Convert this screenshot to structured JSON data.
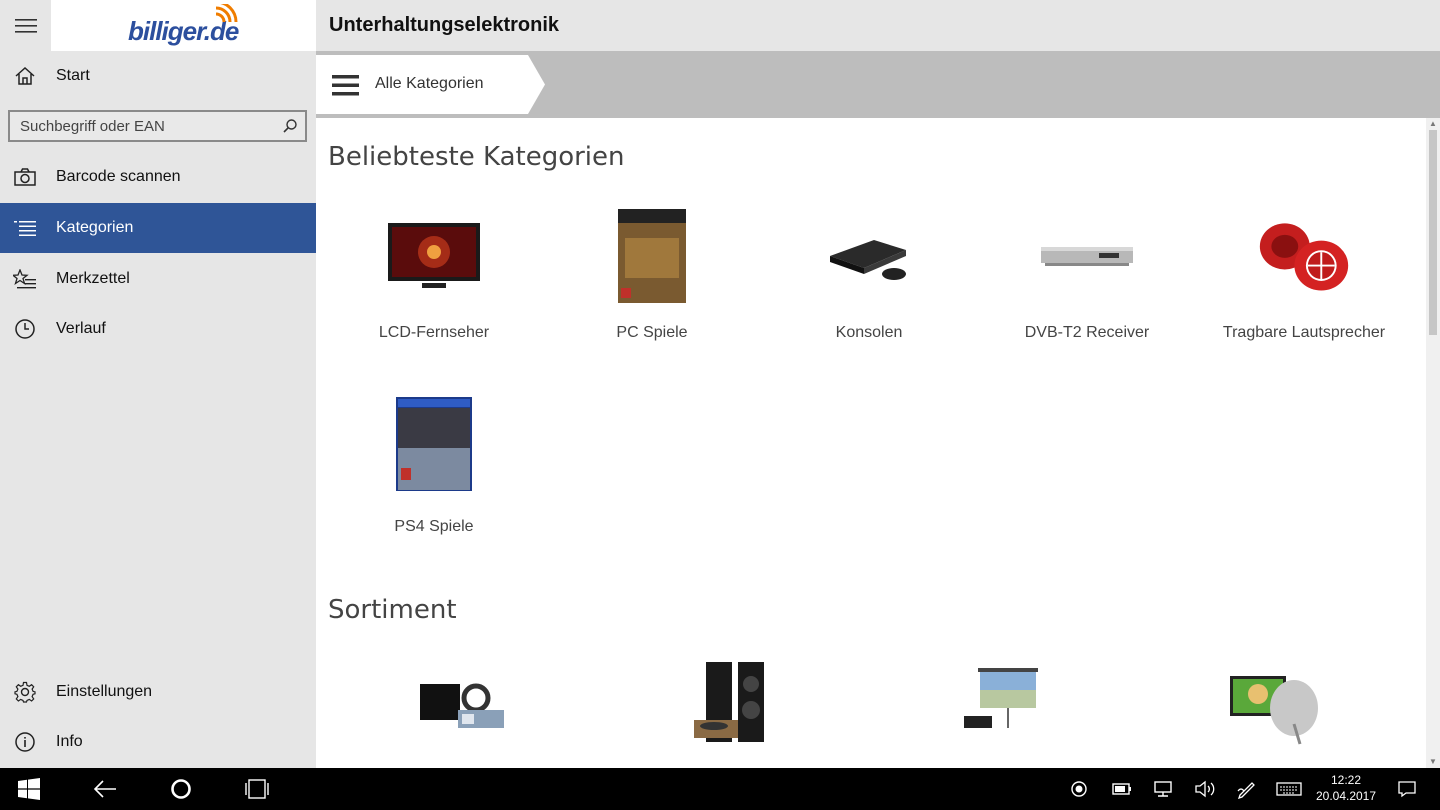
{
  "app": {
    "logo_text": "billiger.de",
    "page_title": "Unterhaltungselektronik"
  },
  "sidebar": {
    "search_placeholder": "Suchbegriff oder EAN",
    "items": [
      {
        "label": "Start",
        "icon": "home-icon"
      },
      {
        "label": "Barcode scannen",
        "icon": "camera-icon"
      },
      {
        "label": "Kategorien",
        "icon": "list-icon",
        "active": true
      },
      {
        "label": "Merkzettel",
        "icon": "star-list-icon"
      },
      {
        "label": "Verlauf",
        "icon": "clock-icon"
      }
    ],
    "bottom_items": [
      {
        "label": "Einstellungen",
        "icon": "gear-icon"
      },
      {
        "label": "Info",
        "icon": "info-icon"
      }
    ]
  },
  "breadcrumb": {
    "label": "Alle Kategorien"
  },
  "sections": {
    "popular_title": "Beliebteste Kategorien",
    "popular": [
      {
        "label": "LCD-Fernseher"
      },
      {
        "label": "PC Spiele"
      },
      {
        "label": "Konsolen"
      },
      {
        "label": "DVB-T2 Receiver"
      },
      {
        "label": "Tragbare Lautsprecher"
      },
      {
        "label": "PS4 Spiele"
      }
    ],
    "assortment_title": "Sortiment"
  },
  "taskbar": {
    "time": "12:22",
    "date": "20.04.2017"
  },
  "colors": {
    "accent": "#2f5597",
    "sidebar_bg": "#e6e6e6",
    "breadcrumb_bg": "#bdbdbd",
    "logo_orange": "#f07d00",
    "logo_blue": "#2c4f9e"
  }
}
